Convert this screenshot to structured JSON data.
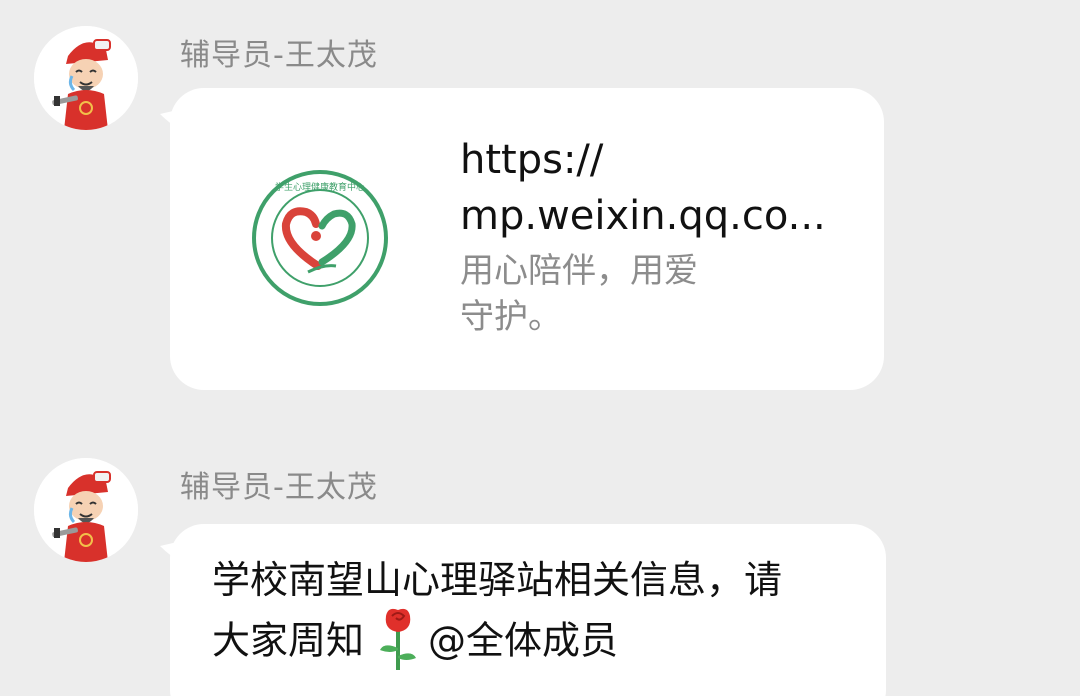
{
  "messages": [
    {
      "sender": "辅导员-王太茂",
      "type": "link-card",
      "url_line1": "https://",
      "url_line2": "mp.weixin.qq.co...",
      "desc_line1": "用心陪伴，用爱",
      "desc_line2": "守护。",
      "logo_text": "学生心理健康教育中心"
    },
    {
      "sender": "辅导员-王太茂",
      "type": "text",
      "line1": "学校南望山心理驿站相关信息，请",
      "line2_pre": "大家周知",
      "line2_emoji": "rose-emoji",
      "line2_post": "@全体成员"
    }
  ],
  "colors": {
    "background": "#EDEDED",
    "bubble": "#FFFFFF",
    "sender_name": "#8A8A8A",
    "logo_green": "#3FA06A",
    "logo_red": "#D9433A"
  }
}
